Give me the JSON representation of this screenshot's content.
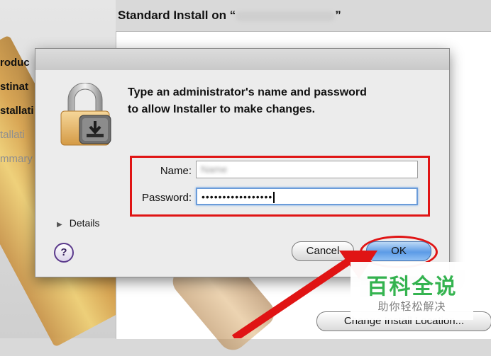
{
  "background": {
    "window_title": "Standard Install on “",
    "window_title_end": "”",
    "steps": [
      "roduc",
      "stinat",
      "stallati",
      "tallati",
      "mmary"
    ],
    "change_location_button": "Change Install Location..."
  },
  "dialog": {
    "message_line1": "Type an administrator's name and password",
    "message_line2": "to allow Installer to make changes.",
    "name_label": "Name:",
    "name_value": "Name",
    "password_label": "Password:",
    "password_value": "•••••••••••••••••",
    "details_label": "Details",
    "help_label": "?",
    "cancel_label": "Cancel",
    "ok_label": "OK"
  },
  "watermark": {
    "main": "百科全说",
    "sub": "助你轻松解决"
  },
  "colors": {
    "highlight_red": "#e01414",
    "ok_blue": "#5c9be6",
    "watermark_green": "#2fb24b"
  }
}
